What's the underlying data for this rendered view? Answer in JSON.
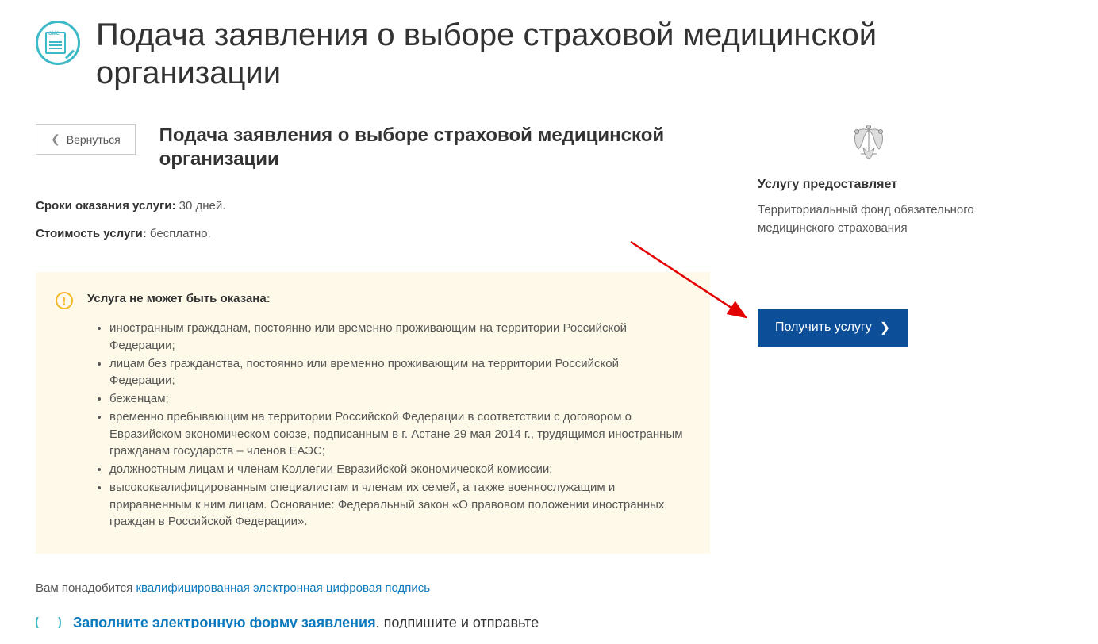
{
  "pageTitle": "Подача заявления о выборе страховой медицинской организации",
  "backLabel": "Вернуться",
  "subtitle": "Подача заявления о выборе страховой медицинской организации",
  "durationLabel": "Сроки оказания услуги:",
  "durationValue": " 30 дней.",
  "costLabel": "Стоимость услуги:",
  "costValue": " бесплатно.",
  "warning": {
    "title": "Услуга не может быть оказана:",
    "items": [
      "иностранным гражданам, постоянно или временно проживающим на территории Российской Федерации;",
      "лицам без гражданства, постоянно или временно проживающим на территории Российской Федерации;",
      "беженцам;",
      "временно пребывающим на территории Российской Федерации в соответствии с договором о Евразийском экономическом союзе, подписанным в г. Астане 29 мая 2014 г., трудящимся иностранным гражданам государств – членов ЕАЭС;",
      "должностным лицам и членам Коллегии Евразийской экономической комиссии;",
      "высококвалифицированным специалистам и членам их семей, а также военнослужащим и приравненным к ним лицам. Основание: Федеральный закон «О правовом положении иностранных граждан в Российской Федерации»."
    ]
  },
  "footerPrefix": "Вам понадобится ",
  "footerLink": "квалифицированная электронная цифровая подпись",
  "provider": {
    "label": "Услугу предоставляет",
    "name": "Территориальный фонд обязательного медицинского страхования"
  },
  "ctaLabel": "Получить услугу",
  "step": {
    "highlight": "Заполните электронную форму заявления",
    "rest": ", подпишите и отправьте"
  }
}
